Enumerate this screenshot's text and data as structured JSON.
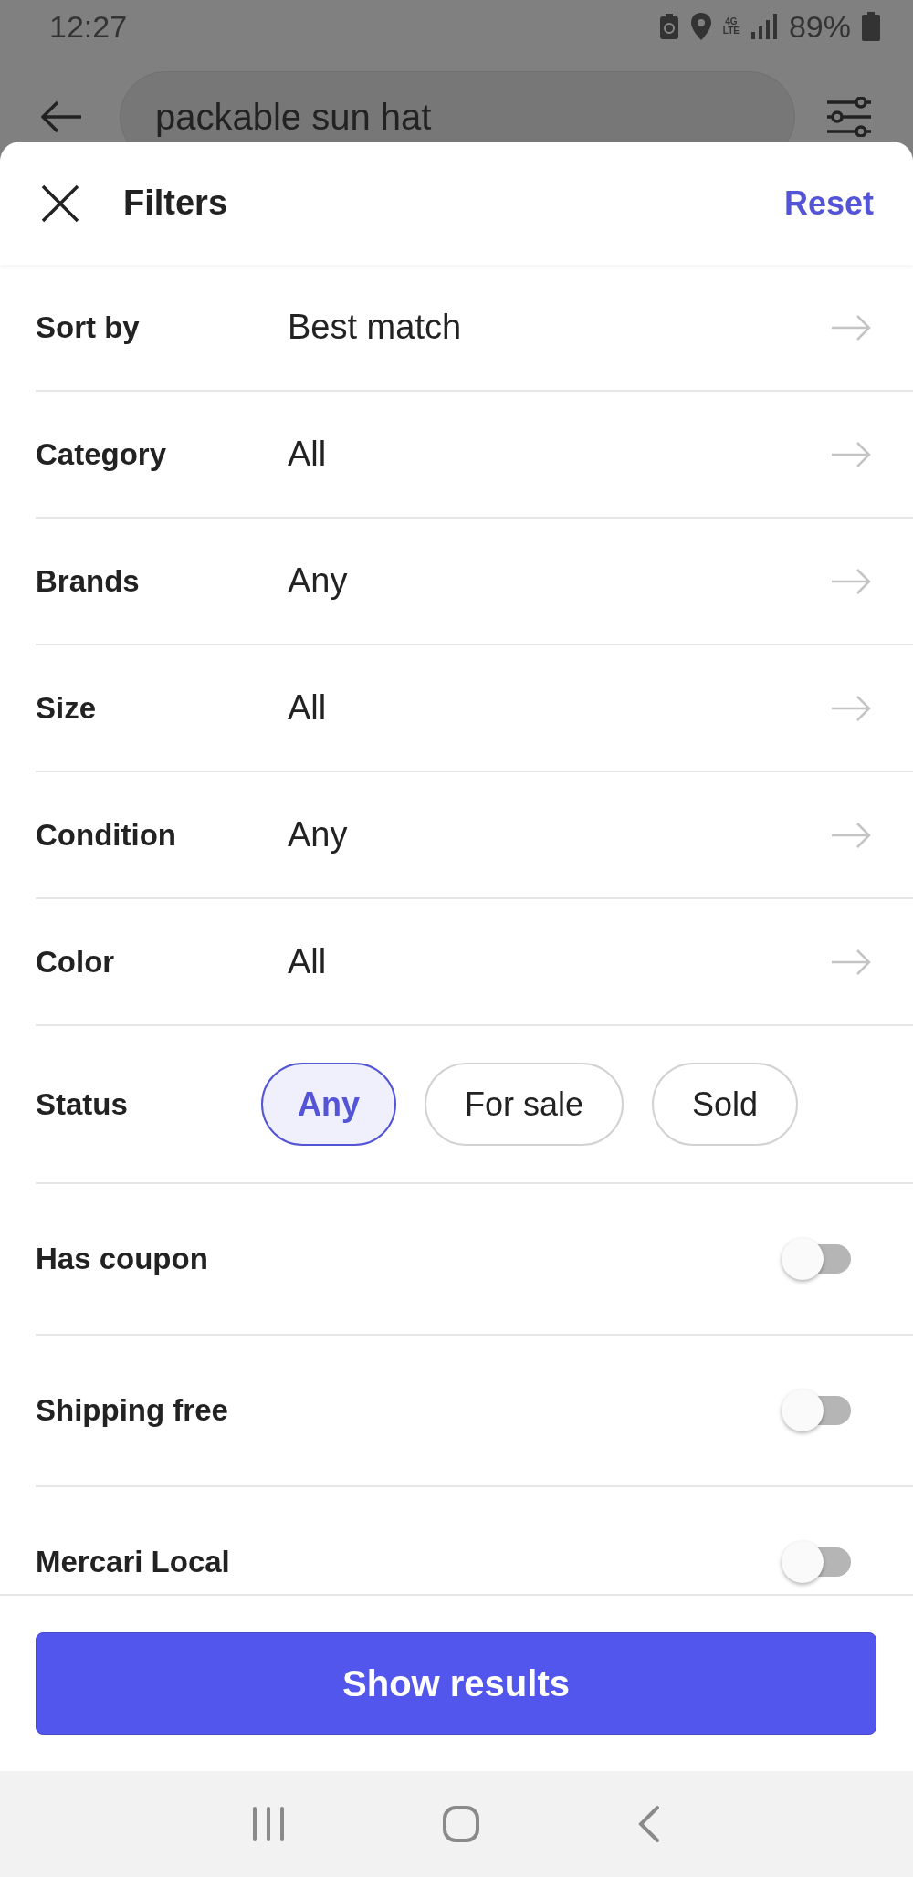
{
  "status_bar": {
    "time": "12:27",
    "network_top": "4G",
    "network_bottom": "LTE",
    "battery": "89%"
  },
  "search": {
    "value": "packable sun hat"
  },
  "sheet": {
    "title": "Filters",
    "reset": "Reset"
  },
  "filters": [
    {
      "kind": "link",
      "label": "Sort by",
      "value": "Best match"
    },
    {
      "kind": "link",
      "label": "Category",
      "value": "All"
    },
    {
      "kind": "link",
      "label": "Brands",
      "value": "Any"
    },
    {
      "kind": "link",
      "label": "Size",
      "value": "All"
    },
    {
      "kind": "link",
      "label": "Condition",
      "value": "Any"
    },
    {
      "kind": "link",
      "label": "Color",
      "value": "All"
    },
    {
      "kind": "choice",
      "label": "Status",
      "options": [
        {
          "label": "Any",
          "selected": true
        },
        {
          "label": "For sale",
          "selected": false
        },
        {
          "label": "Sold",
          "selected": false
        }
      ]
    },
    {
      "kind": "toggle",
      "label": "Has coupon",
      "on": false
    },
    {
      "kind": "toggle",
      "label": "Shipping free",
      "on": false
    },
    {
      "kind": "toggle",
      "label": "Mercari Local",
      "on": false
    }
  ],
  "primary_button": "Show results"
}
